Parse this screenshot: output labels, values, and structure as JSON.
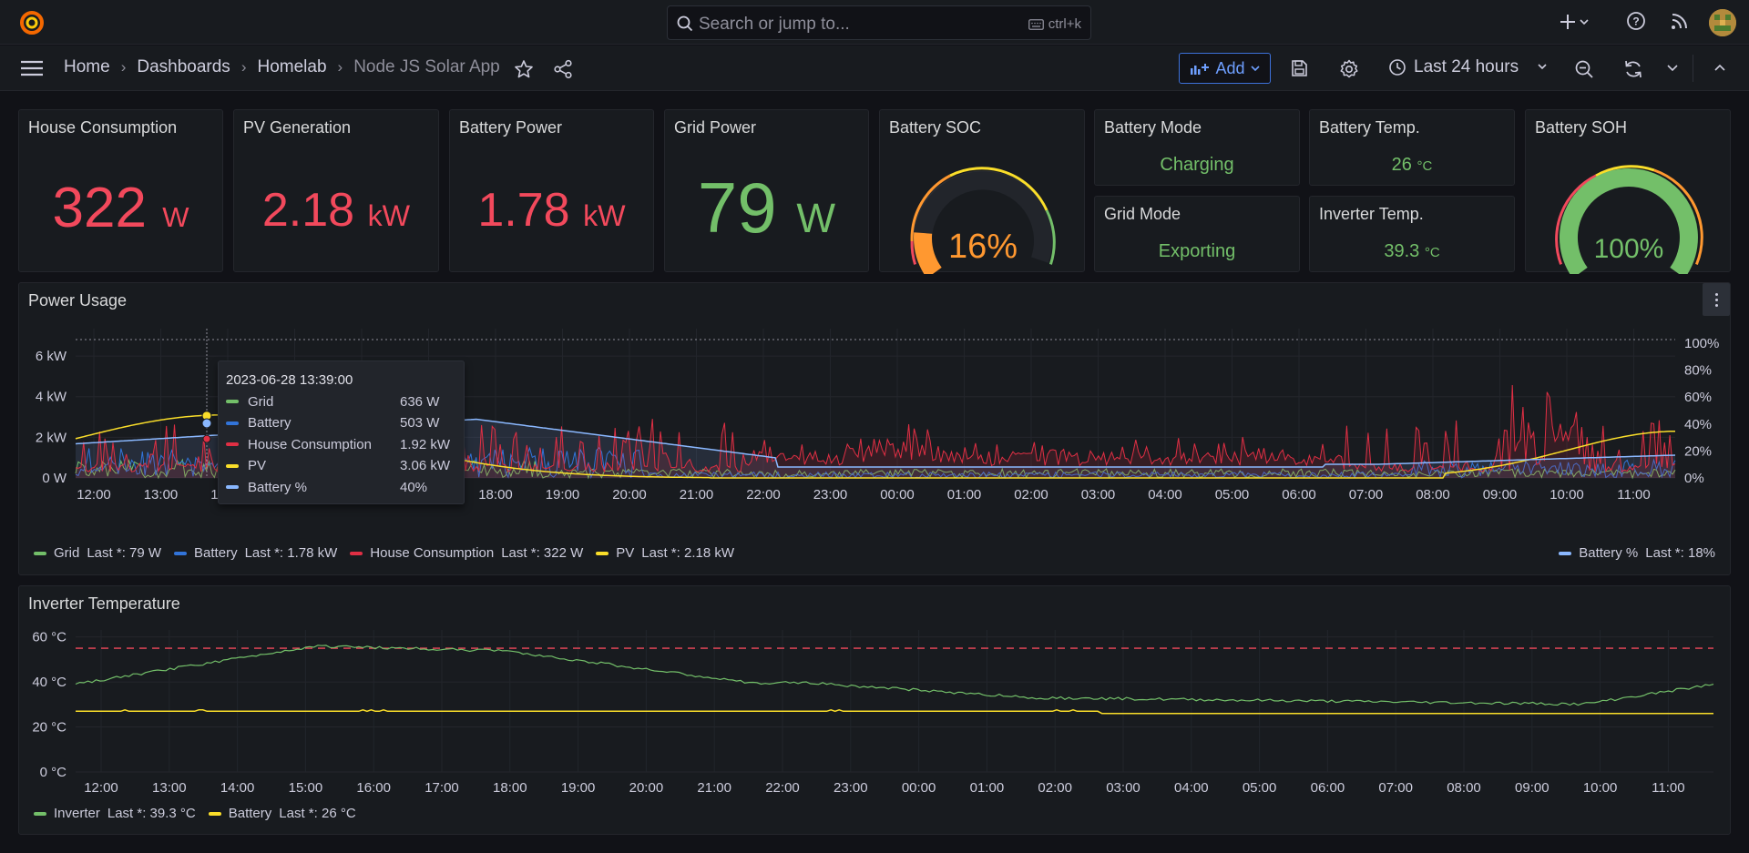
{
  "topbar": {
    "search_placeholder": "Search or jump to...",
    "search_shortcut": "ctrl+k"
  },
  "breadcrumb": [
    "Home",
    "Dashboards",
    "Homelab",
    "Node JS Solar App"
  ],
  "toolbar": {
    "add_label": "Add",
    "time_range": "Last 24 hours"
  },
  "stats": {
    "house_consumption": {
      "title": "House Consumption",
      "value": "322",
      "unit": "W"
    },
    "pv_generation": {
      "title": "PV Generation",
      "value": "2.18",
      "unit": "kW"
    },
    "battery_power": {
      "title": "Battery Power",
      "value": "1.78",
      "unit": "kW"
    },
    "grid_power": {
      "title": "Grid Power",
      "value": "79",
      "unit": "W"
    },
    "battery_soc": {
      "title": "Battery SOC",
      "value": "16%",
      "fraction": 0.16
    },
    "battery_mode": {
      "title": "Battery Mode",
      "value": "Charging"
    },
    "grid_mode": {
      "title": "Grid Mode",
      "value": "Exporting"
    },
    "battery_temp": {
      "title": "Battery Temp.",
      "value": "26",
      "unit": "°C"
    },
    "inverter_temp": {
      "title": "Inverter Temp.",
      "value": "39.3",
      "unit": "°C"
    },
    "battery_soh": {
      "title": "Battery SOH",
      "value": "100%",
      "fraction": 1.0
    }
  },
  "colors": {
    "green": "#73bf69",
    "blue": "#5794f2",
    "red": "#f2495c",
    "yellow": "#fade2a",
    "light_blue": "#8ab8ff",
    "orange": "#ff9830"
  },
  "power_usage": {
    "title": "Power Usage",
    "y_left_ticks": [
      "0 W",
      "2 kW",
      "4 kW",
      "6 kW"
    ],
    "y_right_ticks": [
      "0%",
      "20%",
      "40%",
      "60%",
      "80%",
      "100%"
    ],
    "x_ticks": [
      "12:00",
      "13:00",
      "14:00",
      "15:00",
      "16:00",
      "17:00",
      "18:00",
      "19:00",
      "20:00",
      "21:00",
      "22:00",
      "23:00",
      "00:00",
      "01:00",
      "02:00",
      "03:00",
      "04:00",
      "05:00",
      "06:00",
      "07:00",
      "08:00",
      "09:00",
      "10:00",
      "11:00"
    ],
    "legend": [
      {
        "name": "Grid",
        "last": "Last *: 79 W",
        "color": "#73bf69"
      },
      {
        "name": "Battery",
        "last": "Last *: 1.78 kW",
        "color": "#3274d9"
      },
      {
        "name": "House Consumption",
        "last": "Last *: 322 W",
        "color": "#e02f44"
      },
      {
        "name": "PV",
        "last": "Last *: 2.18 kW",
        "color": "#fade2a"
      }
    ],
    "legend_right": {
      "name": "Battery %",
      "last": "Last *: 18%",
      "color": "#8ab8ff"
    },
    "tooltip": {
      "time": "2023-06-28 13:39:00",
      "rows": [
        {
          "name": "Grid",
          "value": "636 W",
          "color": "#73bf69"
        },
        {
          "name": "Battery",
          "value": "503 W",
          "color": "#3274d9"
        },
        {
          "name": "House Consumption",
          "value": "1.92 kW",
          "color": "#e02f44"
        },
        {
          "name": "PV",
          "value": "3.06 kW",
          "color": "#fade2a"
        },
        {
          "name": "Battery %",
          "value": "40%",
          "color": "#8ab8ff"
        }
      ]
    }
  },
  "inverter_temperature": {
    "title": "Inverter Temperature",
    "y_ticks": [
      "0 °C",
      "20 °C",
      "40 °C",
      "60 °C"
    ],
    "x_ticks": [
      "12:00",
      "13:00",
      "14:00",
      "15:00",
      "16:00",
      "17:00",
      "18:00",
      "19:00",
      "20:00",
      "21:00",
      "22:00",
      "23:00",
      "00:00",
      "01:00",
      "02:00",
      "03:00",
      "04:00",
      "05:00",
      "06:00",
      "07:00",
      "08:00",
      "09:00",
      "10:00",
      "11:00"
    ],
    "legend": [
      {
        "name": "Inverter",
        "last": "Last *: 39.3 °C",
        "color": "#73bf69"
      },
      {
        "name": "Battery",
        "last": "Last *: 26 °C",
        "color": "#fade2a"
      }
    ]
  }
}
